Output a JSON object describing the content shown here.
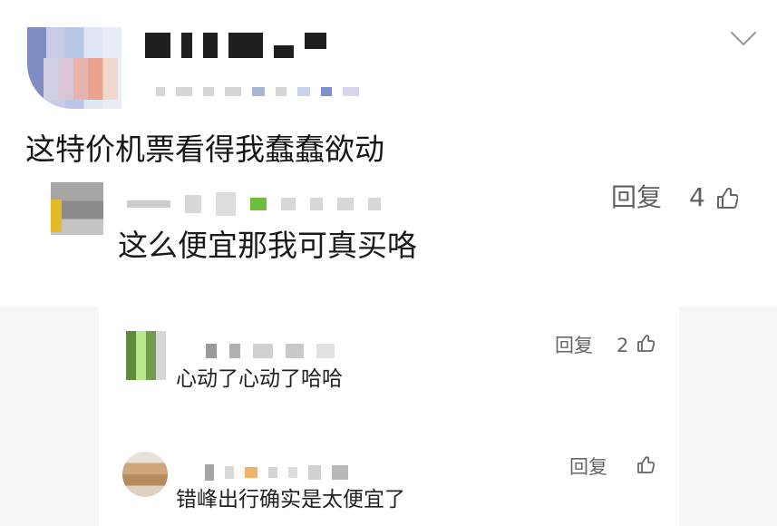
{
  "main_comment": {
    "text": "这特价机票看得我蠢蠢欲动"
  },
  "reply": {
    "text": "这么便宜那我可真买咯",
    "reply_label": "回复",
    "likes": "4"
  },
  "sub_replies": [
    {
      "text": "心动了心动了哈哈",
      "reply_label": "回复",
      "likes": "2"
    },
    {
      "text": "错峰出行确实是太便宜了",
      "reply_label": "回复"
    }
  ],
  "icons": {
    "collapse": "chevron-down-icon",
    "like": "thumbs-up-icon"
  },
  "colors": {
    "text": "#1c1c1c",
    "muted": "#606060",
    "panel": "#f6f6f6"
  }
}
